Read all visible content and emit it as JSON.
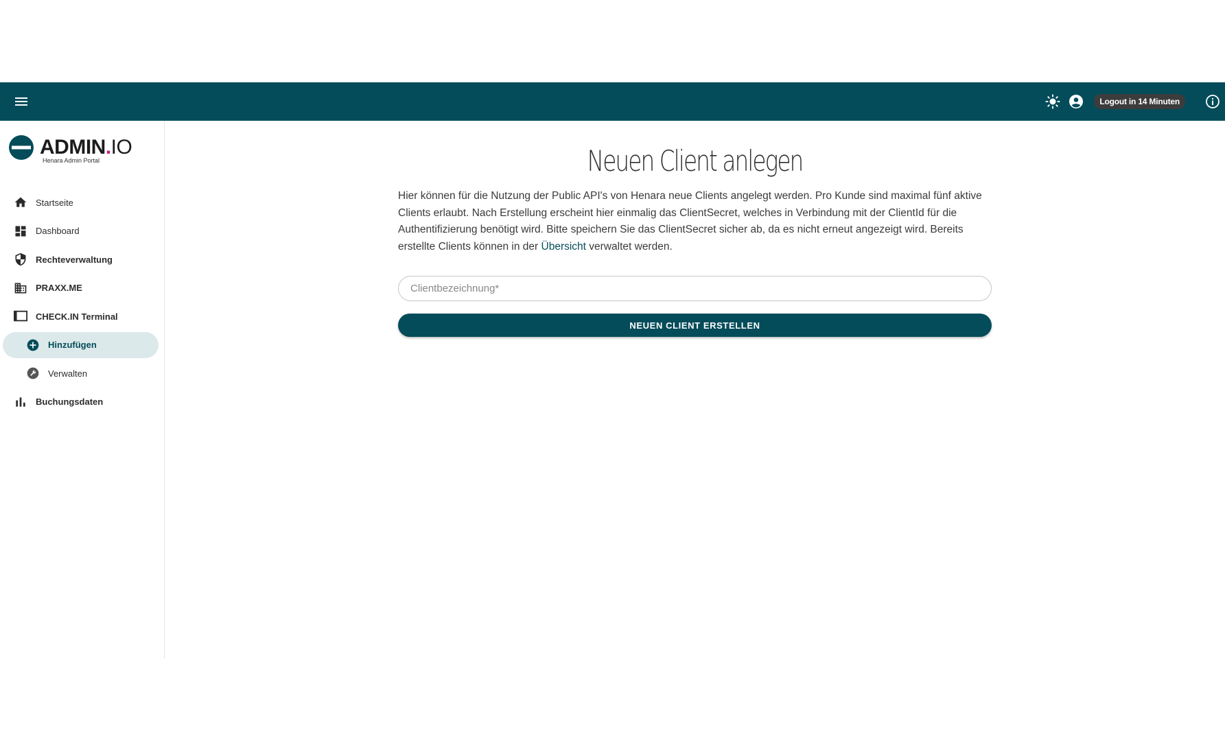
{
  "header": {
    "logout_label": "Logout in 14 Minuten",
    "icons": [
      "menu-icon",
      "sun-icon",
      "account-icon",
      "info-icon"
    ],
    "background_color": "#044c5a"
  },
  "brand": {
    "name": "ADMIN",
    "dot": ".",
    "suffix": "IO",
    "subtitle": "Henara Admin Portal",
    "accent_color": "#c2227a"
  },
  "sidebar": {
    "items": [
      {
        "label": "Startseite",
        "icon": "home-icon"
      },
      {
        "label": "Dashboard",
        "icon": "dashboard-icon"
      },
      {
        "label": "Rechteverwaltung",
        "icon": "shield-icon"
      },
      {
        "label": "PRAXX.ME",
        "icon": "building-icon"
      },
      {
        "label": "CHECK.IN Terminal",
        "icon": "terminal-icon"
      },
      {
        "label": "Hinzufügen",
        "icon": "add-circle-icon",
        "active": true
      },
      {
        "label": "Verwalten",
        "icon": "wrench-icon"
      },
      {
        "label": "Buchungsdaten",
        "icon": "bar-chart-icon"
      }
    ]
  },
  "main": {
    "title": "Neuen Client anlegen",
    "intro_before_link": "Hier können für die Nutzung der Public API's von Henara neue Clients angelegt werden. Pro Kunde sind maximal fünf aktive Clients erlaubt. Nach Erstellung erscheint hier einmalig das ClientSecret, welches in Verbindung mit der ClientId für die Authentifizierung benötigt wird. Bitte speichern Sie das ClientSecret sicher ab, da es nicht erneut angezeigt wird. Bereits erstellte Clients können in der ",
    "intro_link": "Übersicht",
    "intro_after_link": " verwaltet werden.",
    "input_placeholder": "Clientbezeichnung*",
    "input_value": "",
    "submit_label": "NEUEN CLIENT ERSTELLEN"
  }
}
